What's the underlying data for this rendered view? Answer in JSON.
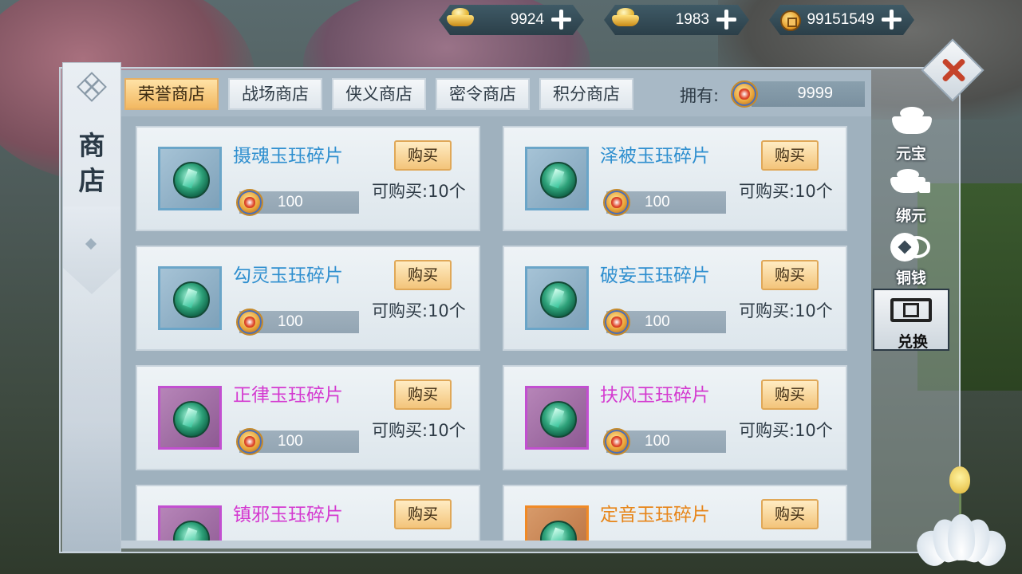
{
  "currencies": [
    {
      "name": "bound-ingot",
      "value": "9924"
    },
    {
      "name": "ingot",
      "value": "1983"
    },
    {
      "name": "copper",
      "value": "99151549"
    }
  ],
  "left_banner": {
    "title_line1": "商",
    "title_line2": "店"
  },
  "tabs": [
    {
      "label": "荣誉商店",
      "active": true
    },
    {
      "label": "战场商店",
      "active": false
    },
    {
      "label": "侠义商店",
      "active": false
    },
    {
      "label": "密令商店",
      "active": false
    },
    {
      "label": "积分商店",
      "active": false
    }
  ],
  "owned": {
    "label": "拥有:",
    "value": "9999"
  },
  "items": [
    {
      "name": "摄魂玉珏碎片",
      "price": "100",
      "buy": "购买",
      "limit": "可购买:10个",
      "quality": "blue"
    },
    {
      "name": "泽被玉珏碎片",
      "price": "100",
      "buy": "购买",
      "limit": "可购买:10个",
      "quality": "blue"
    },
    {
      "name": "勾灵玉珏碎片",
      "price": "100",
      "buy": "购买",
      "limit": "可购买:10个",
      "quality": "blue"
    },
    {
      "name": "破妄玉珏碎片",
      "price": "100",
      "buy": "购买",
      "limit": "可购买:10个",
      "quality": "blue"
    },
    {
      "name": "正律玉珏碎片",
      "price": "100",
      "buy": "购买",
      "limit": "可购买:10个",
      "quality": "purple"
    },
    {
      "name": "扶风玉珏碎片",
      "price": "100",
      "buy": "购买",
      "limit": "可购买:10个",
      "quality": "purple"
    },
    {
      "name": "镇邪玉珏碎片",
      "price": "",
      "buy": "购买",
      "limit": "",
      "quality": "purple"
    },
    {
      "name": "定音玉珏碎片",
      "price": "",
      "buy": "购买",
      "limit": "",
      "quality": "orange"
    }
  ],
  "side_tabs": [
    {
      "label": "元宝",
      "icon": "ingot-icon",
      "active": false
    },
    {
      "label": "绑元",
      "icon": "bound-ingot-icon",
      "active": false
    },
    {
      "label": "铜钱",
      "icon": "copper-coin-icon",
      "active": false
    },
    {
      "label": "兑换",
      "icon": "exchange-ticket-icon",
      "active": true
    }
  ],
  "colors": {
    "blue_name": "#2f8fcf",
    "purple_name": "#d43ad0",
    "orange_name": "#e78518",
    "active_tab": "#f2b861"
  }
}
